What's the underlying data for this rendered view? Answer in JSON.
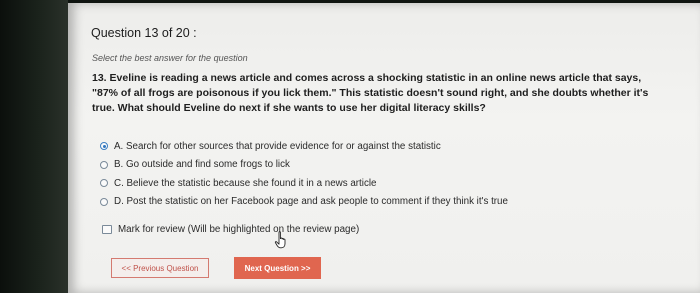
{
  "question": {
    "header": "Question 13 of 20 :",
    "instruction": "Select the best answer for the question",
    "text": "13.  Eveline is reading a news article and comes across a shocking statistic in an online news article that says, \"87% of all frogs are poisonous if you lick them.\" This statistic doesn't sound right, and she doubts whether it's true. What should Eveline do next if she wants to use her digital literacy skills?"
  },
  "options": [
    {
      "label": "A. Search for other sources that provide evidence for or against the statistic",
      "selected": true
    },
    {
      "label": "B. Go outside and find some frogs to lick",
      "selected": false
    },
    {
      "label": "C. Believe the statistic because she found it in a news article",
      "selected": false
    },
    {
      "label": "D. Post the statistic on her Facebook page and ask people to comment if they think it's true",
      "selected": false
    }
  ],
  "review": {
    "label": "Mark for review (Will be highlighted on the review page)",
    "checked": false
  },
  "nav": {
    "prev_label": "<< Previous Question",
    "next_label": "Next Question >>"
  },
  "colors": {
    "accent": "#e0664f",
    "radio_selected": "#2f75bd"
  },
  "icons": {
    "cursor": "hand-pointer-icon"
  }
}
